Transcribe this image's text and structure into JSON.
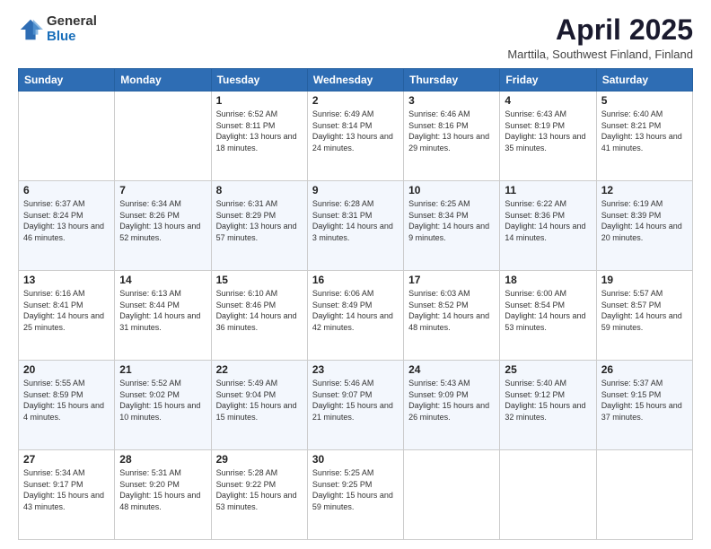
{
  "logo": {
    "general": "General",
    "blue": "Blue"
  },
  "title": "April 2025",
  "subtitle": "Marttila, Southwest Finland, Finland",
  "days": [
    "Sunday",
    "Monday",
    "Tuesday",
    "Wednesday",
    "Thursday",
    "Friday",
    "Saturday"
  ],
  "weeks": [
    [
      {
        "day": "",
        "sunrise": "",
        "sunset": "",
        "daylight": ""
      },
      {
        "day": "",
        "sunrise": "",
        "sunset": "",
        "daylight": ""
      },
      {
        "day": "1",
        "sunrise": "Sunrise: 6:52 AM",
        "sunset": "Sunset: 8:11 PM",
        "daylight": "Daylight: 13 hours and 18 minutes."
      },
      {
        "day": "2",
        "sunrise": "Sunrise: 6:49 AM",
        "sunset": "Sunset: 8:14 PM",
        "daylight": "Daylight: 13 hours and 24 minutes."
      },
      {
        "day": "3",
        "sunrise": "Sunrise: 6:46 AM",
        "sunset": "Sunset: 8:16 PM",
        "daylight": "Daylight: 13 hours and 29 minutes."
      },
      {
        "day": "4",
        "sunrise": "Sunrise: 6:43 AM",
        "sunset": "Sunset: 8:19 PM",
        "daylight": "Daylight: 13 hours and 35 minutes."
      },
      {
        "day": "5",
        "sunrise": "Sunrise: 6:40 AM",
        "sunset": "Sunset: 8:21 PM",
        "daylight": "Daylight: 13 hours and 41 minutes."
      }
    ],
    [
      {
        "day": "6",
        "sunrise": "Sunrise: 6:37 AM",
        "sunset": "Sunset: 8:24 PM",
        "daylight": "Daylight: 13 hours and 46 minutes."
      },
      {
        "day": "7",
        "sunrise": "Sunrise: 6:34 AM",
        "sunset": "Sunset: 8:26 PM",
        "daylight": "Daylight: 13 hours and 52 minutes."
      },
      {
        "day": "8",
        "sunrise": "Sunrise: 6:31 AM",
        "sunset": "Sunset: 8:29 PM",
        "daylight": "Daylight: 13 hours and 57 minutes."
      },
      {
        "day": "9",
        "sunrise": "Sunrise: 6:28 AM",
        "sunset": "Sunset: 8:31 PM",
        "daylight": "Daylight: 14 hours and 3 minutes."
      },
      {
        "day": "10",
        "sunrise": "Sunrise: 6:25 AM",
        "sunset": "Sunset: 8:34 PM",
        "daylight": "Daylight: 14 hours and 9 minutes."
      },
      {
        "day": "11",
        "sunrise": "Sunrise: 6:22 AM",
        "sunset": "Sunset: 8:36 PM",
        "daylight": "Daylight: 14 hours and 14 minutes."
      },
      {
        "day": "12",
        "sunrise": "Sunrise: 6:19 AM",
        "sunset": "Sunset: 8:39 PM",
        "daylight": "Daylight: 14 hours and 20 minutes."
      }
    ],
    [
      {
        "day": "13",
        "sunrise": "Sunrise: 6:16 AM",
        "sunset": "Sunset: 8:41 PM",
        "daylight": "Daylight: 14 hours and 25 minutes."
      },
      {
        "day": "14",
        "sunrise": "Sunrise: 6:13 AM",
        "sunset": "Sunset: 8:44 PM",
        "daylight": "Daylight: 14 hours and 31 minutes."
      },
      {
        "day": "15",
        "sunrise": "Sunrise: 6:10 AM",
        "sunset": "Sunset: 8:46 PM",
        "daylight": "Daylight: 14 hours and 36 minutes."
      },
      {
        "day": "16",
        "sunrise": "Sunrise: 6:06 AM",
        "sunset": "Sunset: 8:49 PM",
        "daylight": "Daylight: 14 hours and 42 minutes."
      },
      {
        "day": "17",
        "sunrise": "Sunrise: 6:03 AM",
        "sunset": "Sunset: 8:52 PM",
        "daylight": "Daylight: 14 hours and 48 minutes."
      },
      {
        "day": "18",
        "sunrise": "Sunrise: 6:00 AM",
        "sunset": "Sunset: 8:54 PM",
        "daylight": "Daylight: 14 hours and 53 minutes."
      },
      {
        "day": "19",
        "sunrise": "Sunrise: 5:57 AM",
        "sunset": "Sunset: 8:57 PM",
        "daylight": "Daylight: 14 hours and 59 minutes."
      }
    ],
    [
      {
        "day": "20",
        "sunrise": "Sunrise: 5:55 AM",
        "sunset": "Sunset: 8:59 PM",
        "daylight": "Daylight: 15 hours and 4 minutes."
      },
      {
        "day": "21",
        "sunrise": "Sunrise: 5:52 AM",
        "sunset": "Sunset: 9:02 PM",
        "daylight": "Daylight: 15 hours and 10 minutes."
      },
      {
        "day": "22",
        "sunrise": "Sunrise: 5:49 AM",
        "sunset": "Sunset: 9:04 PM",
        "daylight": "Daylight: 15 hours and 15 minutes."
      },
      {
        "day": "23",
        "sunrise": "Sunrise: 5:46 AM",
        "sunset": "Sunset: 9:07 PM",
        "daylight": "Daylight: 15 hours and 21 minutes."
      },
      {
        "day": "24",
        "sunrise": "Sunrise: 5:43 AM",
        "sunset": "Sunset: 9:09 PM",
        "daylight": "Daylight: 15 hours and 26 minutes."
      },
      {
        "day": "25",
        "sunrise": "Sunrise: 5:40 AM",
        "sunset": "Sunset: 9:12 PM",
        "daylight": "Daylight: 15 hours and 32 minutes."
      },
      {
        "day": "26",
        "sunrise": "Sunrise: 5:37 AM",
        "sunset": "Sunset: 9:15 PM",
        "daylight": "Daylight: 15 hours and 37 minutes."
      }
    ],
    [
      {
        "day": "27",
        "sunrise": "Sunrise: 5:34 AM",
        "sunset": "Sunset: 9:17 PM",
        "daylight": "Daylight: 15 hours and 43 minutes."
      },
      {
        "day": "28",
        "sunrise": "Sunrise: 5:31 AM",
        "sunset": "Sunset: 9:20 PM",
        "daylight": "Daylight: 15 hours and 48 minutes."
      },
      {
        "day": "29",
        "sunrise": "Sunrise: 5:28 AM",
        "sunset": "Sunset: 9:22 PM",
        "daylight": "Daylight: 15 hours and 53 minutes."
      },
      {
        "day": "30",
        "sunrise": "Sunrise: 5:25 AM",
        "sunset": "Sunset: 9:25 PM",
        "daylight": "Daylight: 15 hours and 59 minutes."
      },
      {
        "day": "",
        "sunrise": "",
        "sunset": "",
        "daylight": ""
      },
      {
        "day": "",
        "sunrise": "",
        "sunset": "",
        "daylight": ""
      },
      {
        "day": "",
        "sunrise": "",
        "sunset": "",
        "daylight": ""
      }
    ]
  ]
}
